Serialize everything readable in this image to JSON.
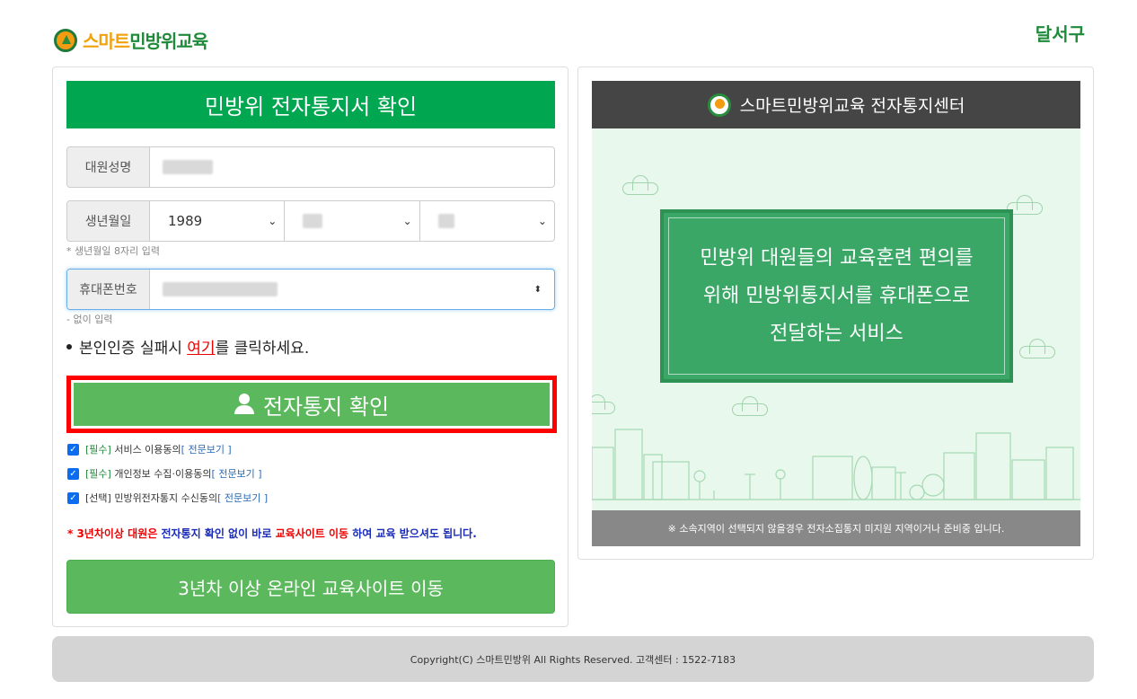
{
  "header": {
    "logo_part1": "스마트",
    "logo_part2": "민방위교육",
    "district": "달서구"
  },
  "form": {
    "title": "민방위 전자통지서 확인",
    "name_label": "대원성명",
    "birth_label": "생년월일",
    "birth_year": "1989",
    "birth_hint": "* 생년월일 8자리 입력",
    "phone_label": "휴대폰번호",
    "phone_hint": "- 없이 입력",
    "auth_note_pre": "본인인증 실패시 ",
    "auth_note_link": "여기",
    "auth_note_post": "를 클릭하세요.",
    "confirm_button": "전자통지 확인",
    "consents": [
      {
        "tag": "[필수]",
        "text": " 서비스 이용동의",
        "link": "[ 전문보기 ]"
      },
      {
        "tag": "[필수]",
        "text": " 개인정보 수집·이용동의",
        "link": "[ 전문보기 ]"
      },
      {
        "tag": "[선택]",
        "text": " 민방위전자통지 수신동의",
        "link": "[ 전문보기 ]"
      }
    ],
    "notice_1": "* 3년차이상 대원은 ",
    "notice_2": "전자통지 확인 없이 바로 ",
    "notice_3": "교육사이트 이동",
    "notice_4": " 하여 교육 받으셔도 됩니다.",
    "move_button": "3년차 이상 온라인 교육사이트 이동"
  },
  "info": {
    "title": "스마트민방위교육 전자통지센터",
    "lines": [
      "민방위 대원들의 교육훈련 편의를",
      "위해 민방위통지서를 휴대폰으로",
      "전달하는 서비스"
    ],
    "footer_note": "※ 소속지역이 선택되지 않을경우 전자소집통지 미지원 지역이거나 준비중 입니다."
  },
  "footer": {
    "copyright": "Copyright(C) 스마트민방위 All Rights Reserved. 고객센터 : 1522-7183"
  },
  "colors": {
    "brand_green": "#00a650",
    "button_green": "#5cb85c",
    "highlight_red": "#ff0000"
  }
}
